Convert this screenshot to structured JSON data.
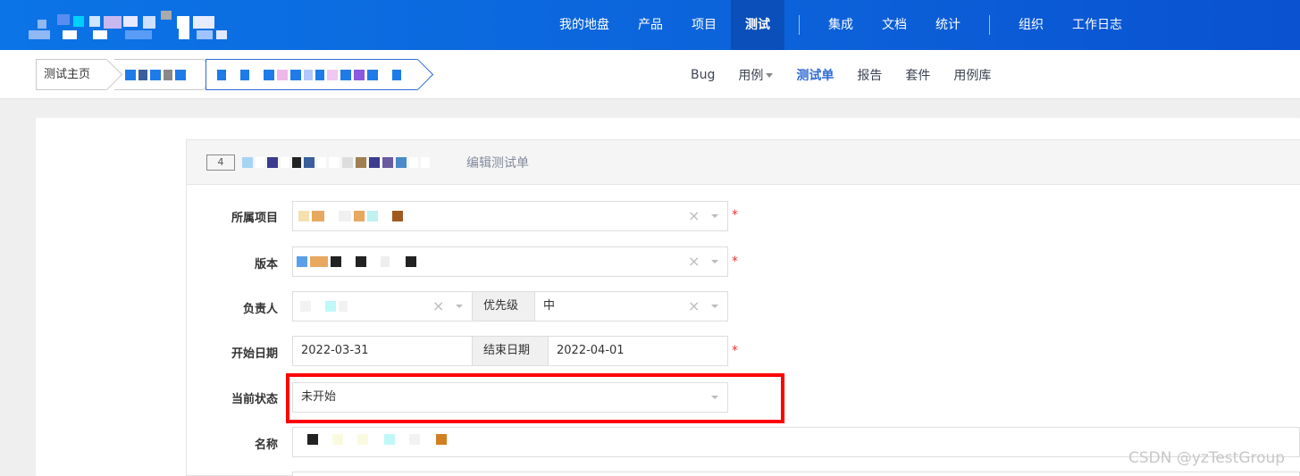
{
  "topnav": {
    "items": [
      "我的地盘",
      "产品",
      "项目",
      "测试",
      "集成",
      "文档",
      "统计",
      "组织",
      "工作日志"
    ],
    "active": "测试"
  },
  "breadcrumb": {
    "home": "测试主页"
  },
  "subnav": {
    "items": [
      "Bug",
      "用例",
      "测试单",
      "报告",
      "套件",
      "用例库"
    ],
    "active": "测试单"
  },
  "panel": {
    "id": "4",
    "title": "编辑测试单"
  },
  "form": {
    "project_label": "所属项目",
    "build_label": "版本",
    "owner_label": "负责人",
    "priority_label": "优先级",
    "priority_value": "中",
    "begin_label": "开始日期",
    "begin_value": "2022-03-31",
    "end_label": "结束日期",
    "end_value": "2022-04-01",
    "status_label": "当前状态",
    "status_value": "未开始",
    "name_label": "名称"
  },
  "symbols": {
    "clear": "×",
    "required": "*"
  },
  "watermark": "CSDN @yzTestGroup",
  "colors": {
    "topbar": "#0c62da",
    "accent": "#2e6bd6",
    "highlight": "#ff0000",
    "required": "#e53333"
  }
}
